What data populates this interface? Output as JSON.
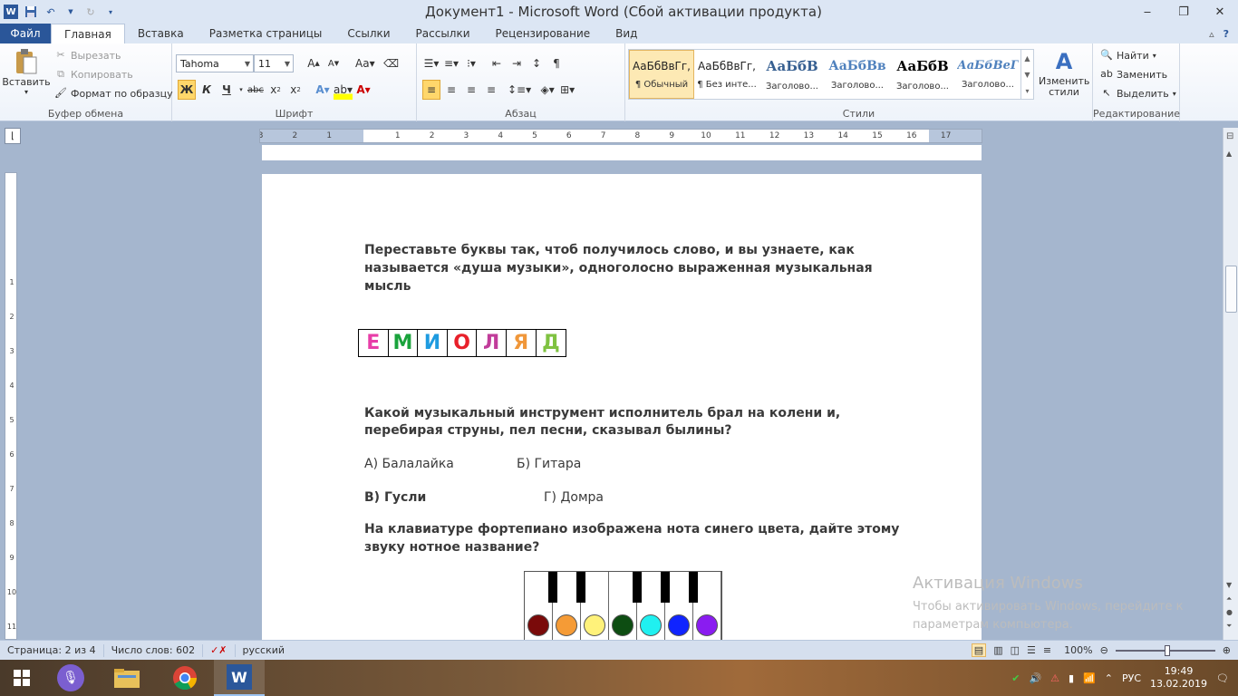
{
  "window": {
    "title": "Документ1 - Microsoft Word (Сбой активации продукта)"
  },
  "tabs": [
    "Файл",
    "Главная",
    "Вставка",
    "Разметка страницы",
    "Ссылки",
    "Рассылки",
    "Рецензирование",
    "Вид"
  ],
  "ribbon": {
    "clipboard": {
      "paste": "Вставить",
      "cut": "Вырезать",
      "copy": "Копировать",
      "format_painter": "Формат по образцу",
      "label": "Буфер обмена"
    },
    "font": {
      "name": "Tahoma",
      "size": "11",
      "label": "Шрифт",
      "bold": "Ж",
      "italic": "К",
      "underline": "Ч"
    },
    "paragraph": {
      "label": "Абзац"
    },
    "styles": {
      "label": "Стили",
      "items": [
        {
          "sample": "АаБбВвГг,",
          "name": "¶ Обычный"
        },
        {
          "sample": "АаБбВвГг,",
          "name": "¶ Без инте..."
        },
        {
          "sample": "АаБбВ",
          "name": "Заголово..."
        },
        {
          "sample": "АаБбВв",
          "name": "Заголово..."
        },
        {
          "sample": "АаБбВ",
          "name": "Заголово..."
        },
        {
          "sample": "АаБбВеГ",
          "name": "Заголово..."
        }
      ],
      "change": "Изменить стили"
    },
    "editing": {
      "label": "Редактирование",
      "find": "Найти",
      "replace": "Заменить",
      "select": "Выделить"
    }
  },
  "document": {
    "q1": "Переставьте буквы так, чтоб получилось слово, и вы узнаете, как называется «душа музыки», одноголосно выраженная музыкальная мысль",
    "letters": [
      {
        "ch": "Е",
        "color": "#e83ea8"
      },
      {
        "ch": "М",
        "color": "#1aa33c"
      },
      {
        "ch": "И",
        "color": "#1e9be0"
      },
      {
        "ch": "О",
        "color": "#e8202a"
      },
      {
        "ch": "Л",
        "color": "#c13c9a"
      },
      {
        "ch": "Я",
        "color": "#f0973a"
      },
      {
        "ch": "Д",
        "color": "#7fc241"
      }
    ],
    "q2": "Какой музыкальный инструмент исполнитель брал на колени и, перебирая струны, пел песни, сказывал былины?",
    "opt_a": "А) Балалайка",
    "opt_b": "Б) Гитара",
    "opt_c": "В) Гусли",
    "opt_d": "Г) Домра",
    "q3": "На клавиатуре фортепиано изображена нота синего цвета, дайте этому звуку нотное название?",
    "piano_colors": [
      "#7a0a0a",
      "#f59b36",
      "#fff27a",
      "#0d4d12",
      "#20f0f0",
      "#1024ff",
      "#8a1cf0"
    ]
  },
  "watermark": {
    "line1": "Активация Windows",
    "line2": "Чтобы активировать Windows, перейдите к",
    "line3": "параметрам компьютера."
  },
  "status": {
    "page": "Страница: 2 из 4",
    "words": "Число слов: 602",
    "language": "русский",
    "zoom": "100%"
  },
  "taskbar": {
    "lang": "РУС",
    "time": "19:49",
    "date": "13.02.2019"
  }
}
